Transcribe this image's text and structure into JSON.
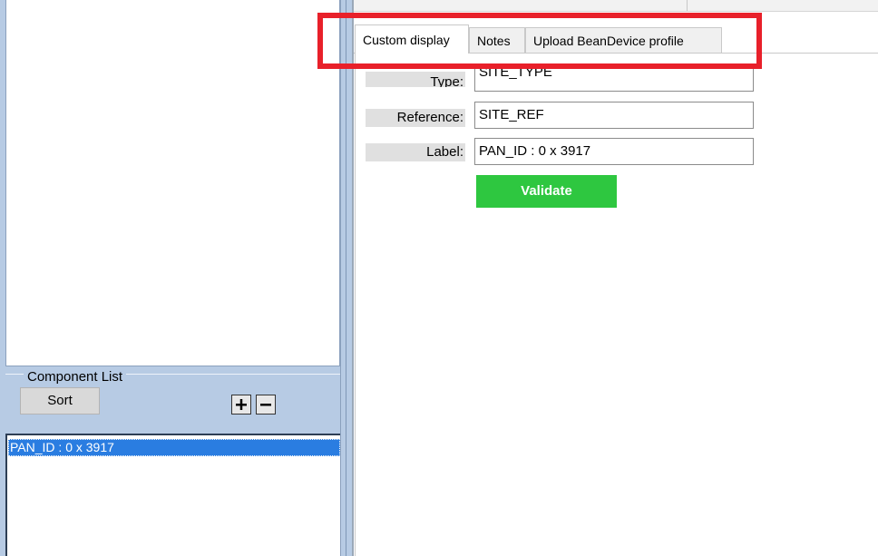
{
  "left_panel": {
    "component_list_title": "Component List",
    "sort_label": "Sort",
    "items": [
      "PAN_ID : 0 x 3917"
    ]
  },
  "tabs": [
    {
      "label": "Custom display",
      "active": true
    },
    {
      "label": "Notes",
      "active": false
    },
    {
      "label": "Upload BeanDevice profile",
      "active": false
    }
  ],
  "form": {
    "type_label": "Type:",
    "type_value": "SITE_TYPE",
    "reference_label": "Reference:",
    "reference_value": "SITE_REF",
    "label_label": "Label:",
    "label_value": "PAN_ID : 0 x 3917",
    "validate_label": "Validate"
  },
  "colors": {
    "highlight": "#e8202a",
    "validate": "#2ec740",
    "selection": "#2a7de1",
    "panel_blue": "#b7cbe4"
  }
}
